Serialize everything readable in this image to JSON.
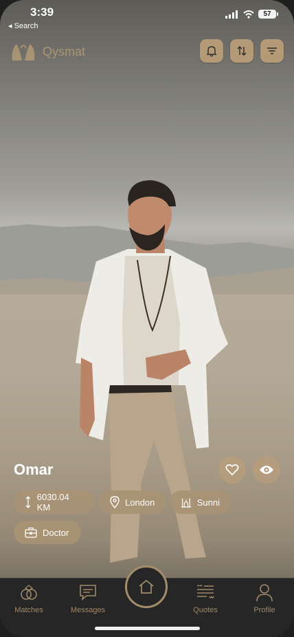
{
  "status_bar": {
    "time": "3:39",
    "back_label": "◂ Search",
    "battery": "57"
  },
  "header": {
    "app_name": "Qysmat",
    "icons": [
      "bell-icon",
      "sort-icon",
      "filter-icon"
    ]
  },
  "profile": {
    "name": "Omar",
    "distance": "6030.04 KM",
    "location": "London",
    "sect": "Sunni",
    "profession": "Doctor"
  },
  "nav": {
    "items": [
      {
        "label": "Matches",
        "icon": "rings-icon"
      },
      {
        "label": "Messages",
        "icon": "chat-icon"
      },
      {
        "label": "Quotes",
        "icon": "quotes-icon"
      },
      {
        "label": "Profile",
        "icon": "person-icon"
      }
    ],
    "center_icon": "home-icon"
  },
  "colors": {
    "accent": "#b49a76",
    "nav_bg": "#262626",
    "nav_text": "#a0886a"
  }
}
